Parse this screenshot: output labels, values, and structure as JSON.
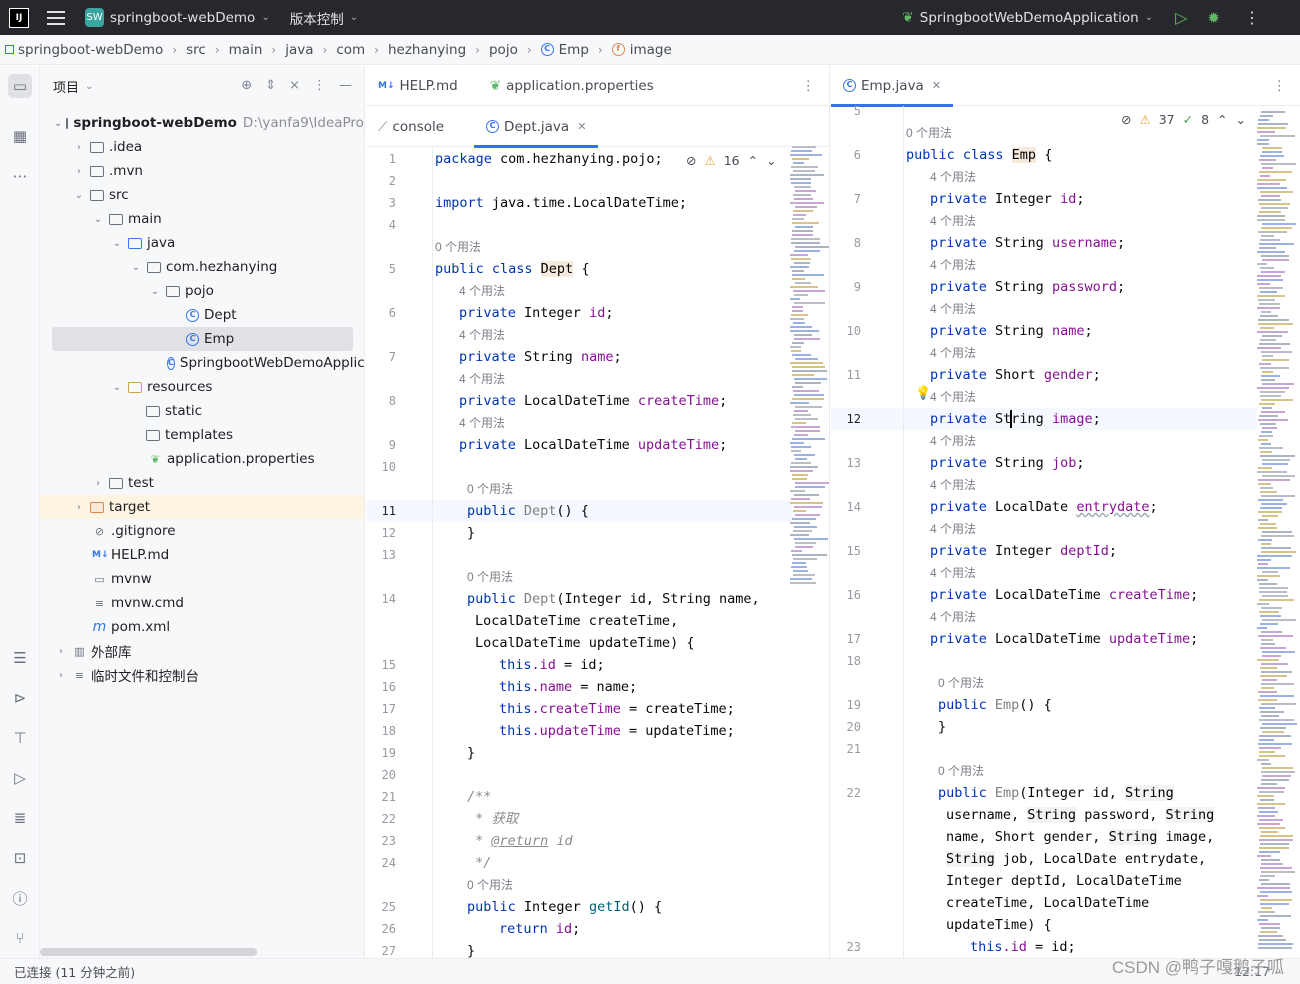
{
  "titlebar": {
    "logo": "IJ",
    "project_badge": "SW",
    "project_name": "springboot-webDemo",
    "vcs_label": "版本控制",
    "run_config": "SpringbootWebDemoApplication"
  },
  "breadcrumb": [
    "springboot-webDemo",
    "src",
    "main",
    "java",
    "com",
    "hezhanying",
    "pojo",
    "Emp",
    "image"
  ],
  "project_panel": {
    "title": "项目",
    "root_name": "springboot-webDemo",
    "root_path": "D:\\yanfa9\\IdeaProjec",
    "items": [
      {
        "label": ".idea"
      },
      {
        "label": ".mvn"
      },
      {
        "label": "src"
      },
      {
        "label": "main"
      },
      {
        "label": "java"
      },
      {
        "label": "com.hezhanying"
      },
      {
        "label": "pojo"
      },
      {
        "label": "Dept"
      },
      {
        "label": "Emp"
      },
      {
        "label": "SpringbootWebDemoApplica"
      },
      {
        "label": "resources"
      },
      {
        "label": "static"
      },
      {
        "label": "templates"
      },
      {
        "label": "application.properties"
      },
      {
        "label": "test"
      },
      {
        "label": "target"
      },
      {
        "label": ".gitignore"
      },
      {
        "label": "HELP.md"
      },
      {
        "label": "mvnw"
      },
      {
        "label": "mvnw.cmd"
      },
      {
        "label": "pom.xml"
      },
      {
        "label": "外部库"
      },
      {
        "label": "临时文件和控制台"
      }
    ]
  },
  "editor_left": {
    "tabs_row1": [
      "HELP.md",
      "application.properties"
    ],
    "tabs_row2": [
      "console",
      "Dept.java"
    ],
    "warning_count": "16",
    "line_numbers": [
      "1",
      "2",
      "3",
      "4",
      "5",
      "6",
      "7",
      "8",
      "9",
      "10",
      "11",
      "12",
      "13",
      "14",
      "15",
      "16",
      "17",
      "18",
      "19",
      "20",
      "21",
      "22",
      "23",
      "24",
      "25",
      "26",
      "27"
    ],
    "usage_hints": [
      "0 个用法",
      "4 个用法",
      "4 个用法",
      "4 个用法",
      "4 个用法",
      "0 个用法",
      "0 个用法",
      "0 个用法"
    ],
    "code": {
      "l1_kw": "package",
      "l1_rest": " com.hezhanying.pojo;",
      "l3_kw": "import",
      "l3_rest": " java.time.LocalDateTime;",
      "l5_a": "public class ",
      "l5_b": "Dept",
      "l5_c": " {",
      "private": "private",
      "t_integer": " Integer ",
      "f_id": "id",
      "t_string": " String ",
      "f_name": "name",
      "t_ldt": " LocalDateTime ",
      "f_create": "createTime",
      "f_update": "updateTime",
      "semi": ";",
      "l11_a": "public ",
      "l11_b": "Dept",
      "l11_c": "() {",
      "brace": "}",
      "l14_a": "public ",
      "l14_b": "Dept",
      "l14_c": "(Integer id, String name,",
      "l14_d": "LocalDateTime createTime,",
      "l14_e": "LocalDateTime updateTime) {",
      "this": "this",
      "l15_rest": " = id;",
      "l16_rest": " = name;",
      "l17_rest": " = createTime;",
      "l18_rest": " = updateTime;",
      "dot_id": ".id",
      "dot_name": ".name",
      "dot_create": ".createTime",
      "dot_update": ".updateTime",
      "l21": "/**",
      "l22": " * 获取",
      "l23_a": " * ",
      "l23_b": "@return",
      "l23_c": " id",
      "l24": " */",
      "l25_a": "public",
      "l25_b": " Integer ",
      "l25_c": "getId",
      "l25_d": "() {",
      "l26_a": "return ",
      "l26_b": "id",
      "l26_c": ";"
    }
  },
  "editor_right": {
    "tab": "Emp.java",
    "warning_count": "37",
    "ok_count": "8",
    "line_numbers": [
      "5",
      "6",
      "7",
      "8",
      "9",
      "10",
      "11",
      "12",
      "13",
      "14",
      "15",
      "16",
      "17",
      "18",
      "19",
      "20",
      "21",
      "22",
      "23"
    ],
    "usage_hints": [
      "0 个用法",
      "4 个用法",
      "4 个用法",
      "4 个用法",
      "4 个用法",
      "4 个用法",
      "4 个用法",
      "4 个用法",
      "4 个用法",
      "4 个用法",
      "4 个用法",
      "4 个用法",
      "4 个用法",
      "0 个用法",
      "0 个用法"
    ],
    "code": {
      "l6_a": "public class ",
      "l6_b": "Emp",
      "l6_c": " {",
      "f_id": "id",
      "f_username": "username",
      "f_password": "password",
      "f_name": "name",
      "f_gender": "gender",
      "f_image": "image",
      "f_job": "job",
      "f_entrydate": "entrydate",
      "f_deptId": "deptId",
      "f_create": "createTime",
      "f_update": "updateTime",
      "t_integer": " Integer ",
      "t_string": " String ",
      "t_short": " Short ",
      "t_localdate": " LocalDate ",
      "t_ldt": " LocalDateTime ",
      "l19_a": "public ",
      "l19_b": "Emp",
      "l19_c": "() {",
      "l22_a": "public ",
      "l22_b": "Emp",
      "l22_c": "(Integer id, ",
      "l22_d": "String",
      "l22_e": "username, ",
      "l22_f": "String",
      "l22_g": " password, ",
      "l22_h": "String",
      "l22_i": "name, Short gender, ",
      "l22_j": "String",
      "l22_k": " image,",
      "l22_l": "String",
      "l22_m": " job, LocalDate entrydate,",
      "l22_n": "Integer deptId, LocalDateTime",
      "l22_o": "createTime, LocalDateTime",
      "l22_p": "updateTime) {",
      "l23_a": "this",
      "l23_b": ".id",
      "l23_c": " = id;"
    }
  },
  "statusbar": {
    "text": "已连接 (11 分钟之前)",
    "position": "12:17",
    "watermark": "CSDN @鸭子嘎鹅子呱"
  },
  "colors": {
    "accent": "#3574f0",
    "keyword": "#0033b3",
    "field": "#871094",
    "warning": "#e6a23c",
    "titlebar_bg": "#27282e"
  }
}
